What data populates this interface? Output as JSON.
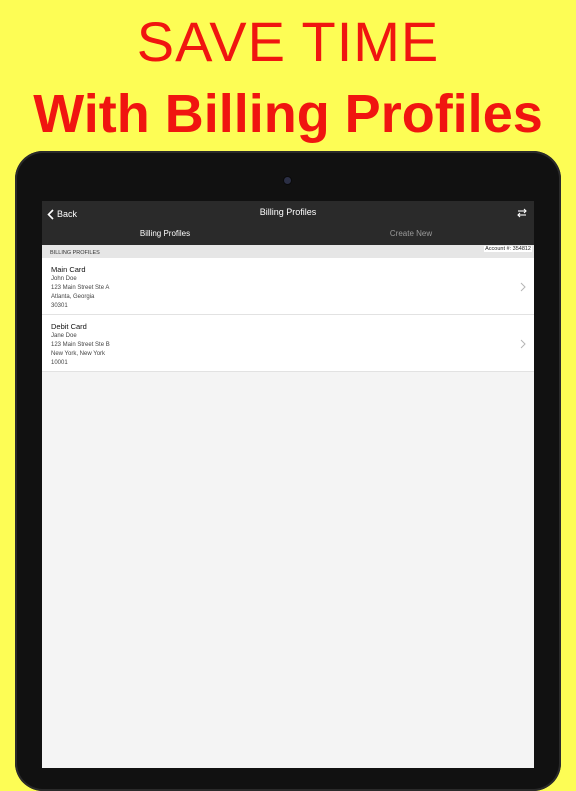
{
  "promo": {
    "headline": "SAVE TIME",
    "subheadline": "With Billing Profiles"
  },
  "navbar": {
    "back_label": "Back",
    "title": "Billing Profiles",
    "swap_icon": "swap-arrows-icon"
  },
  "segments": [
    {
      "label": "Billing Profiles",
      "active": true
    },
    {
      "label": "Create New",
      "active": false
    }
  ],
  "section": {
    "label": "BILLING PROFILES",
    "account": "Account #: 354812"
  },
  "profiles": [
    {
      "name": "Main Card",
      "holder": "John Doe",
      "street": "123 Main Street Ste A",
      "city": "Atlanta, Georgia",
      "zip": "30301"
    },
    {
      "name": "Debit Card",
      "holder": "Jane Doe",
      "street": "123 Main Street Ste B",
      "city": "New York, New York",
      "zip": "10001"
    }
  ],
  "colors": {
    "background": "#fdfd55",
    "headline": "#f01510",
    "navbar": "#2a2a2a"
  }
}
